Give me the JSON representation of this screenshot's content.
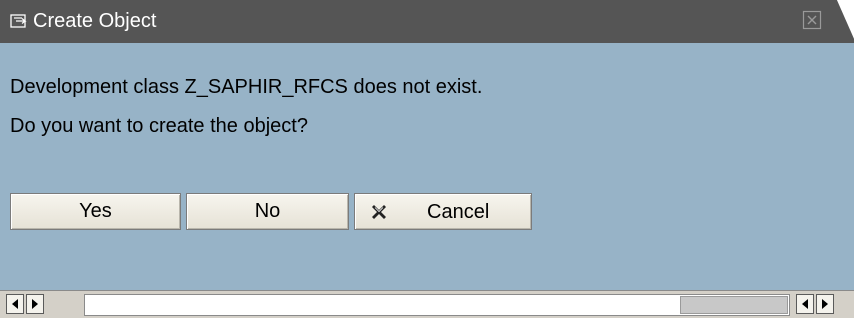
{
  "window": {
    "title": "Create Object"
  },
  "message": {
    "line1": "Development class Z_SAPHIR_RFCS does not exist.",
    "line2": "Do you want to create the object?"
  },
  "buttons": {
    "yes_label": "Yes",
    "no_label": "No",
    "cancel_label": "Cancel"
  },
  "icons": {
    "title": "create-document-icon",
    "close": "close-icon",
    "cancel": "cancel-x-icon"
  },
  "colors": {
    "titlebar": "#555555",
    "content_bg": "#97b3c7",
    "button_bg": "#eeebe2"
  }
}
